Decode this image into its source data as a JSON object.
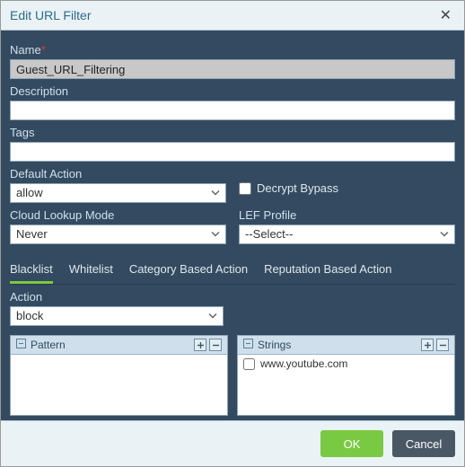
{
  "dialog": {
    "title": "Edit URL Filter"
  },
  "fields": {
    "name_label": "Name",
    "name_value": "Guest_URL_Filtering",
    "description_label": "Description",
    "description_value": "",
    "tags_label": "Tags",
    "tags_value": "",
    "default_action_label": "Default Action",
    "default_action_value": "allow",
    "decrypt_bypass_label": "Decrypt Bypass",
    "cloud_lookup_label": "Cloud Lookup Mode",
    "cloud_lookup_value": "Never",
    "lef_profile_label": "LEF Profile",
    "lef_profile_value": "--Select--"
  },
  "tabs": {
    "items": [
      {
        "label": "Blacklist",
        "active": true
      },
      {
        "label": "Whitelist",
        "active": false
      },
      {
        "label": "Category Based Action",
        "active": false
      },
      {
        "label": "Reputation Based Action",
        "active": false
      }
    ]
  },
  "blacklist": {
    "action_label": "Action",
    "action_value": "block",
    "pattern_grid_title": "Pattern",
    "strings_grid_title": "Strings",
    "strings_rows": [
      {
        "checked": false,
        "value": "www.youtube.com"
      }
    ]
  },
  "buttons": {
    "ok": "OK",
    "cancel": "Cancel"
  }
}
